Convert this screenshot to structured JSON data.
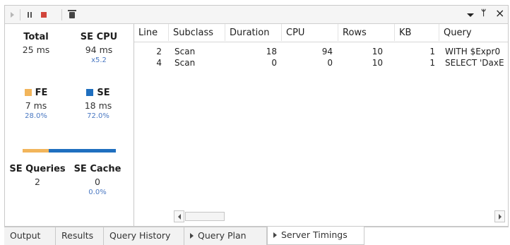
{
  "toolbar": {
    "pin_icon": "pin-icon",
    "close_glyph": "×",
    "pin_glyph": "ᛘ"
  },
  "summary": {
    "total": {
      "label": "Total",
      "value": "25 ms"
    },
    "se_cpu": {
      "label": "SE CPU",
      "value": "94 ms",
      "sub": "x5.2"
    },
    "fe": {
      "label": "FE",
      "value": "7 ms",
      "pct": "28.0%",
      "ratio": 0.28,
      "color": "#f2b55b"
    },
    "se": {
      "label": "SE",
      "value": "18 ms",
      "pct": "72.0%",
      "ratio": 0.72,
      "color": "#1f6fbf"
    },
    "se_queries": {
      "label": "SE Queries",
      "value": "2"
    },
    "se_cache": {
      "label": "SE Cache",
      "value": "0",
      "sub": "0.0%"
    }
  },
  "grid": {
    "columns": [
      "Line",
      "Subclass",
      "Duration",
      "CPU",
      "Rows",
      "KB",
      "Query"
    ],
    "rows": [
      [
        "2",
        "Scan",
        "18",
        "94",
        "10",
        "1",
        "WITH $Expr0"
      ],
      [
        "4",
        "Scan",
        "0",
        "0",
        "10",
        "1",
        "SELECT 'DaxE"
      ]
    ]
  },
  "tabs": [
    {
      "label": "Output",
      "active": false
    },
    {
      "label": "Results",
      "active": false
    },
    {
      "label": "Query History",
      "active": false
    },
    {
      "label": "Query Plan",
      "active": false
    },
    {
      "label": "Server Timings",
      "active": true
    }
  ]
}
